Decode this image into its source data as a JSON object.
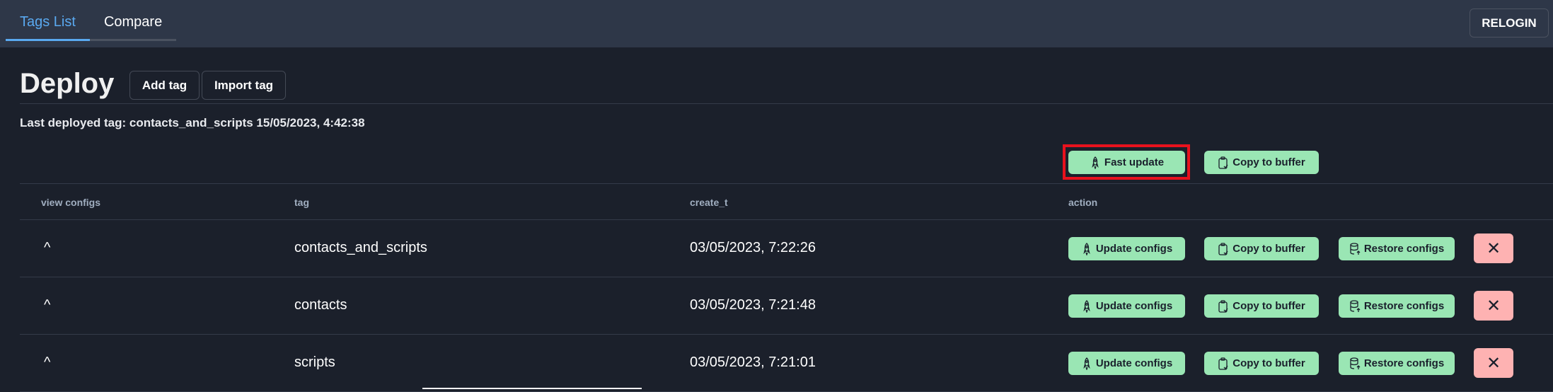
{
  "tabs": [
    {
      "label": "Tags List",
      "active": true
    },
    {
      "label": "Compare",
      "active": false
    }
  ],
  "relogin_label": "RELOGIN",
  "page_title": "Deploy",
  "add_tag_label": "Add tag",
  "import_tag_label": "Import tag",
  "last_deployed": "Last deployed tag: contacts_and_scripts 15/05/2023, 4:42:38",
  "toolbar": {
    "fast_update": "Fast update",
    "copy_to_buffer": "Copy to buffer"
  },
  "columns": [
    "view configs",
    "tag",
    "create_t",
    "action"
  ],
  "rows": [
    {
      "tag": "contacts_and_scripts",
      "create_t": "03/05/2023, 7:22:26"
    },
    {
      "tag": "contacts",
      "create_t": "03/05/2023, 7:21:48"
    },
    {
      "tag": "scripts",
      "create_t": "03/05/2023, 7:21:01"
    }
  ],
  "actions": {
    "update": "Update configs",
    "copy": "Copy to buffer",
    "restore": "Restore configs",
    "delete": "✕",
    "expand": "^"
  },
  "colors": {
    "accent": "#5aa9f0",
    "green_button": "#9ae6b4",
    "delete_button": "#feb2b2",
    "highlight": "#e8121d"
  }
}
